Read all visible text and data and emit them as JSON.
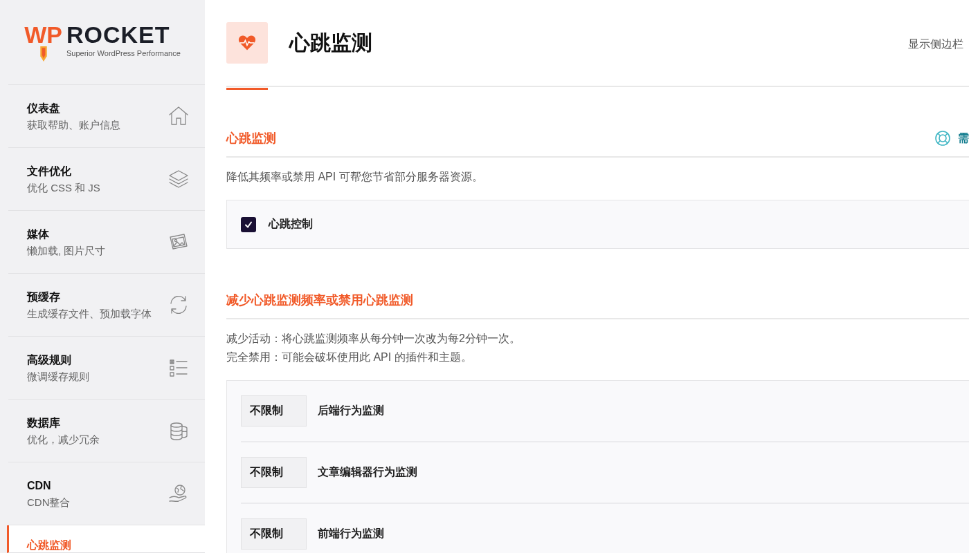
{
  "logo": {
    "brand_accent": "WP",
    "brand": "ROCKET",
    "tagline": "Superior WordPress Performance"
  },
  "sidebar": {
    "items": [
      {
        "title": "仪表盘",
        "subtitle": "获取帮助、账户信息",
        "selected": false
      },
      {
        "title": "文件优化",
        "subtitle": "优化 CSS 和 JS",
        "selected": false
      },
      {
        "title": "媒体",
        "subtitle": "懒加载, 图片尺寸",
        "selected": false
      },
      {
        "title": "预缓存",
        "subtitle": "生成缓存文件、预加载字体",
        "selected": false
      },
      {
        "title": "高级规则",
        "subtitle": "微调缓存规则",
        "selected": false
      },
      {
        "title": "数据库",
        "subtitle": "优化，减少冗余",
        "selected": false
      },
      {
        "title": "CDN",
        "subtitle": "CDN整合",
        "selected": false
      },
      {
        "title": "心跳监测",
        "selected": true
      }
    ]
  },
  "header": {
    "title": "心跳监测",
    "sidebar_toggle": "显示侧边栏"
  },
  "sections": [
    {
      "title": "心跳监测",
      "help": "需",
      "description": [
        "降低其频率或禁用 API 可帮您节省部分服务器资源。"
      ],
      "card": {
        "kind": "checkbox",
        "items": [
          {
            "label": "心跳控制",
            "checked": true
          }
        ]
      }
    },
    {
      "title": "减少心跳监测频率或禁用心跳监测",
      "description": [
        "减少活动：将心跳监测频率从每分钟一次改为每2分钟一次。",
        "完全禁用：可能会破坏使用此 API 的插件和主题。"
      ],
      "card": {
        "kind": "select",
        "items": [
          {
            "value": "不限制",
            "label": "后端行为监测"
          },
          {
            "value": "不限制",
            "label": "文章编辑器行为监测"
          },
          {
            "value": "不限制",
            "label": "前端行为监测"
          }
        ]
      }
    }
  ]
}
